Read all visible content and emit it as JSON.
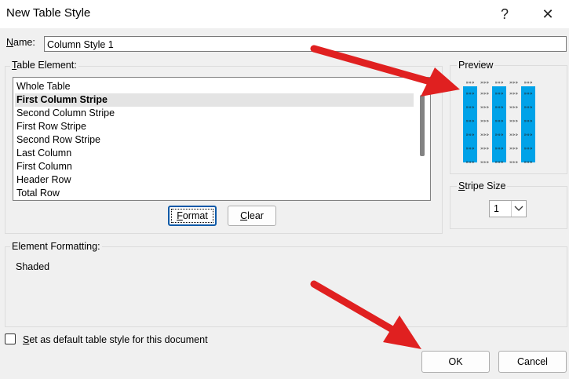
{
  "window": {
    "title": "New Table Style",
    "help_glyph": "?",
    "close_glyph": "✕"
  },
  "name_field": {
    "label_accel": "N",
    "label_rest": "ame:",
    "value": "Column Style 1"
  },
  "table_element": {
    "label_accel": "T",
    "label_rest": "able Element:",
    "items": [
      "Whole Table",
      "First Column Stripe",
      "Second Column Stripe",
      "First Row Stripe",
      "Second Row Stripe",
      "Last Column",
      "First Column",
      "Header Row",
      "Total Row"
    ],
    "selected_index": 1
  },
  "buttons": {
    "format_accel": "F",
    "format_rest": "ormat",
    "clear_accel": "C",
    "clear_rest": "lear",
    "ok": "OK",
    "cancel": "Cancel"
  },
  "preview": {
    "label": "Preview",
    "stripe_color": "#00a2e8",
    "cell_glyph": "»»»"
  },
  "stripe_size": {
    "label_accel": "S",
    "label_rest": "tripe Size",
    "value": "1"
  },
  "element_formatting": {
    "label": "Element Formatting:",
    "value": "Shaded"
  },
  "default_checkbox": {
    "label_accel": "S",
    "label_rest": "et as default table style for this document",
    "checked": false
  },
  "annotation_color": "#e02020"
}
